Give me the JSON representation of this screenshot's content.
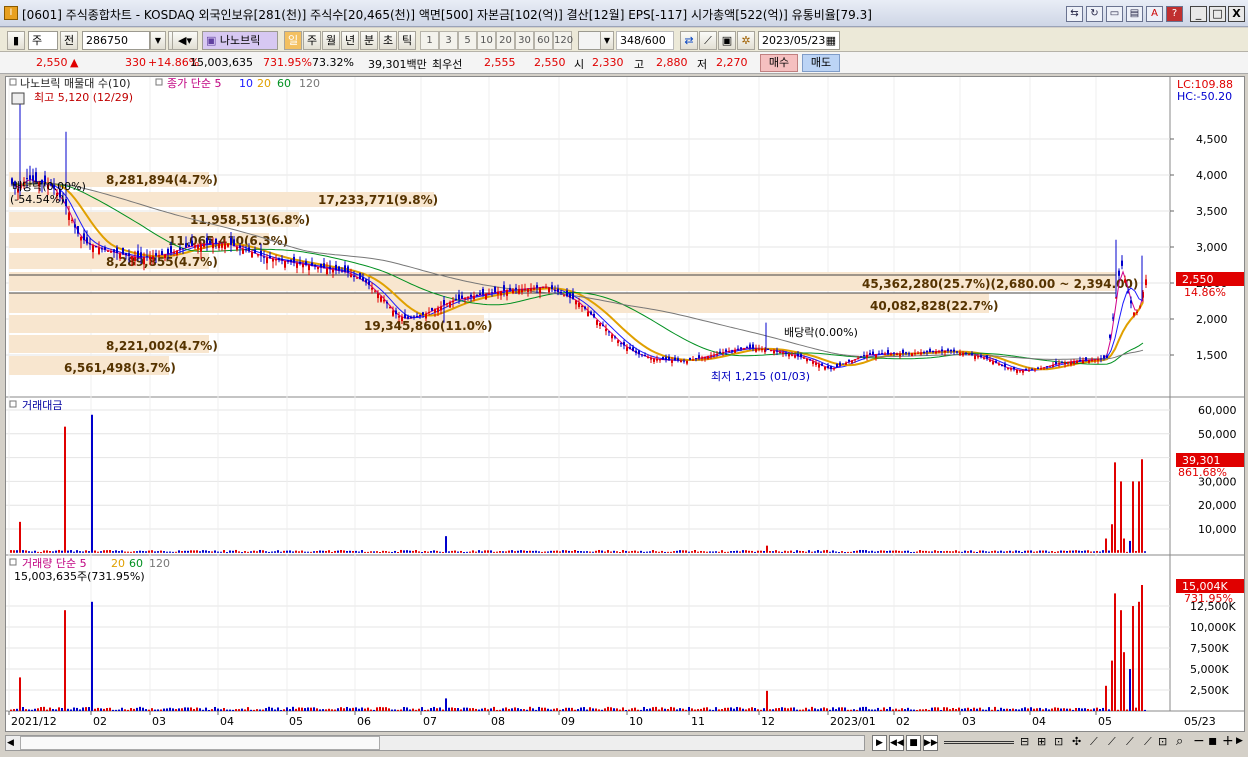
{
  "window": {
    "app_icon": "I",
    "title": "[0601] 주식종합차트 - KOSDAQ 외국인보유[281(천)] 주식수[20,465(천)] 액면[500] 자본금[102(억)] 결산[12월] EPS[-117] 시가총액[522(억)] 유통비율[79.3]",
    "min": "_",
    "max": "□",
    "close": "X"
  },
  "toolbar": {
    "market": "주",
    "market_suffix": "전",
    "code": "286750",
    "stock_name": "나노브릭",
    "periods": [
      "일",
      "주",
      "월",
      "년",
      "분",
      "초",
      "틱"
    ],
    "intervals": [
      "1",
      "3",
      "5",
      "10",
      "20",
      "30",
      "60",
      "120"
    ],
    "count": "348",
    "count_max": "/600",
    "date": "2023/05/23"
  },
  "quote": {
    "price": "2,550",
    "arrow": "▲",
    "change": "330",
    "change_pct": "+14.86%",
    "volume": "15,003,635",
    "vol_ratio": "731.95%",
    "rotation": "73.32%",
    "amount": "39,301백만",
    "best_label": "최우선",
    "best_ask": "2,555",
    "best_bid": "2,550",
    "open_label": "시",
    "open": "2,330",
    "high_label": "고",
    "high": "2,880",
    "low_label": "저",
    "low": "2,270",
    "buy": "매수",
    "sell": "매도"
  },
  "price_panel": {
    "legend_name": "나노브릭 매물대 수(10)",
    "legend_ma": "종가 단순 5",
    "ma_periods": [
      "5",
      "10",
      "20",
      "60",
      "120"
    ],
    "lc": "LC:109.88",
    "hc": "HC:-50.20",
    "high_note": "최고 5,120 (12/29)",
    "low_note": "최저 1,215 (01/03)",
    "div1": "배당락(0.00%)",
    "div2": "배당락(0.00%)",
    "div2_pct": "(-54.54%)",
    "last_price": "2,550",
    "last_pct": "14.86%",
    "y_ticks": [
      "4,500",
      "4,000",
      "3,500",
      "3,000",
      "2,500",
      "2,000",
      "1,500"
    ],
    "volume_profile": [
      "8,281,894(4.7%)",
      "17,233,771(9.8%)",
      "11,958,513(6.8%)",
      "11,065,410(6.3%)",
      "8,289,855(4.7%)",
      "45,362,280(25.7%)(2,680.00 ~ 2,394.00)",
      "40,082,828(22.7%)",
      "19,345,860(11.0%)",
      "8,221,002(4.7%)",
      "6,561,498(3.7%)"
    ]
  },
  "amount_panel": {
    "title": "거래대금",
    "y_ticks": [
      "60,000",
      "50,000",
      "40,000",
      "30,000",
      "20,000",
      "10,000"
    ],
    "last": "39,301",
    "last_pct": "861.68%"
  },
  "volume_panel": {
    "title": "거래량 단순 5",
    "ma_periods": [
      "20",
      "60",
      "120"
    ],
    "info": "15,003,635주(731.95%)",
    "y_ticks": [
      "12,500K",
      "10,000K",
      "7,500K",
      "5,000K",
      "2,500K"
    ],
    "last": "15,004K",
    "last_pct": "731.95%"
  },
  "x_axis": [
    "2021/12",
    "02",
    "03",
    "04",
    "05",
    "06",
    "07",
    "08",
    "09",
    "10",
    "11",
    "12",
    "2023/01",
    "02",
    "03",
    "04",
    "05"
  ],
  "x_right": "05/23",
  "colors": {
    "up": "#e00000",
    "down": "#0000cc",
    "ma5": "#d0008a",
    "ma10": "#1a1aff",
    "ma20": "#e0a000",
    "ma60": "#009020",
    "ma120": "#777777",
    "profile": "#f8e6cf"
  }
}
